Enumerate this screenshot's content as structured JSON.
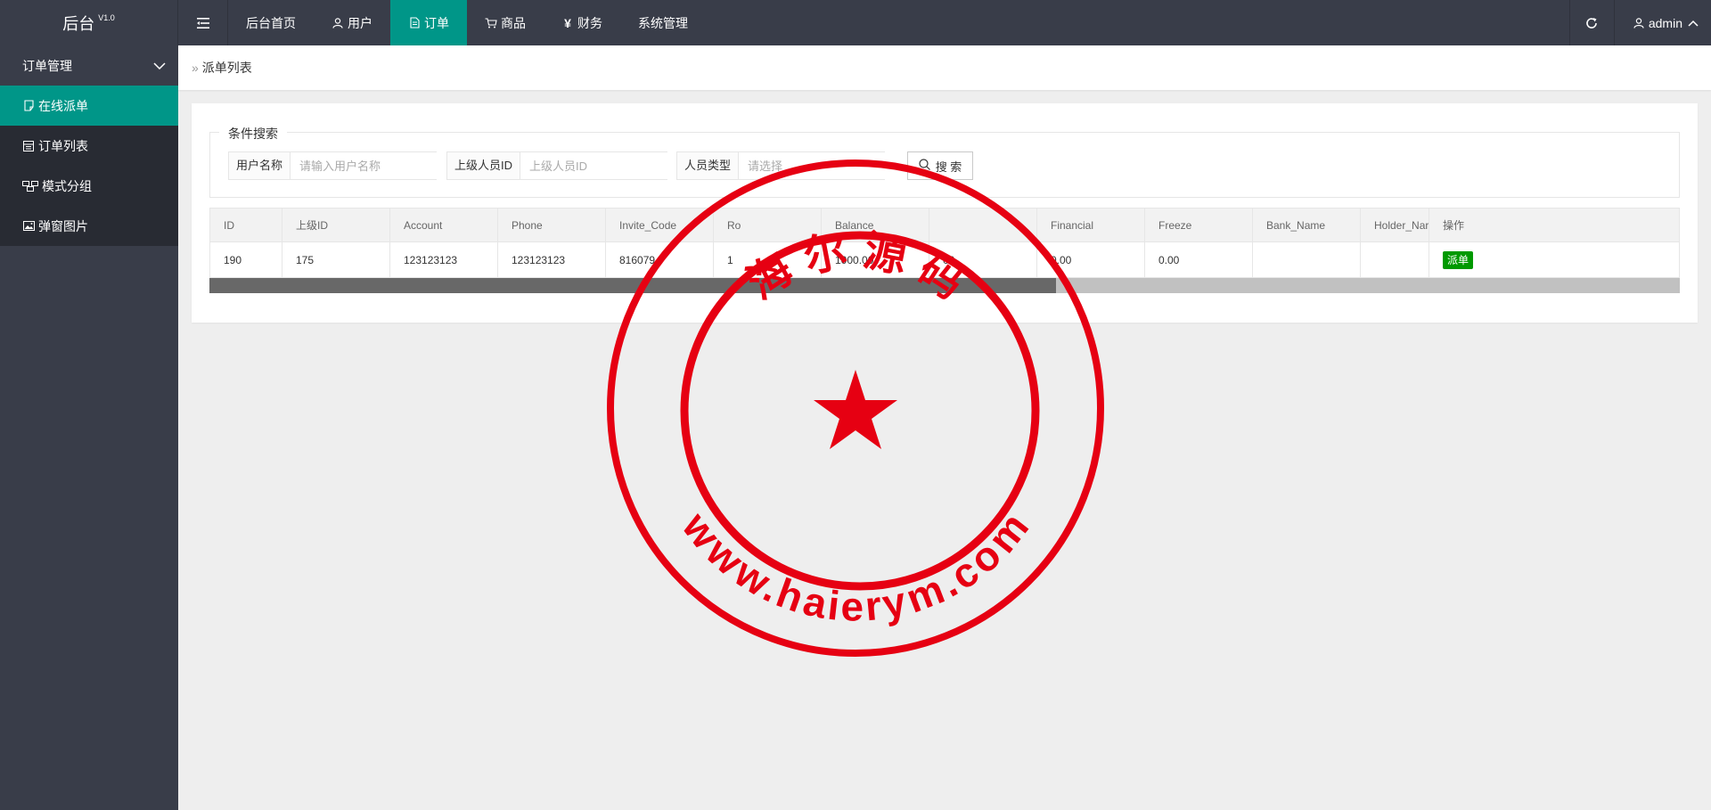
{
  "header": {
    "logo_text": "后台",
    "logo_version": "V1.0",
    "nav": [
      {
        "label": "后台首页",
        "icon": "none",
        "active": false
      },
      {
        "label": "用户",
        "icon": "user-icon",
        "active": false
      },
      {
        "label": "订单",
        "icon": "document-icon",
        "active": true
      },
      {
        "label": "商品",
        "icon": "cart-icon",
        "active": false
      },
      {
        "label": "财务",
        "icon": "yen-icon",
        "active": false
      },
      {
        "label": "系统管理",
        "icon": "none",
        "active": false
      }
    ],
    "user_name": "admin"
  },
  "sidebar": {
    "group_label": "订单管理",
    "items": [
      {
        "label": "在线派单",
        "icon": "note-icon",
        "active": true
      },
      {
        "label": "订单列表",
        "icon": "list-icon",
        "active": false
      },
      {
        "label": "模式分组",
        "icon": "group-icon",
        "active": false
      },
      {
        "label": "弹窗图片",
        "icon": "image-icon",
        "active": false
      }
    ]
  },
  "breadcrumb": {
    "current": "派单列表"
  },
  "search": {
    "legend": "条件搜索",
    "username_label": "用户名称",
    "username_placeholder": "请输入用户名称",
    "parent_label": "上级人员ID",
    "parent_placeholder": "上级人员ID",
    "type_label": "人员类型",
    "type_placeholder": "请选择",
    "button_label": "搜 索"
  },
  "table": {
    "columns": [
      "ID",
      "上级ID",
      "Account",
      "Phone",
      "Invite_Code",
      "Ro",
      "Balance",
      "",
      "Financial",
      "Freeze",
      "Bank_Name",
      "Holder_Nar",
      "操作"
    ],
    "rows": [
      [
        "190",
        "175",
        "123123123",
        "123123123",
        "816079",
        "1",
        "1000.00",
        "00",
        "0.00",
        "0.00",
        "",
        ""
      ]
    ],
    "action_label": "派单"
  },
  "stamp": {
    "top_text": "海 尔 源 码",
    "bottom_text": "www.haierym.com",
    "color": "#e60012"
  },
  "colors": {
    "header_bg": "#393d49",
    "accent": "#009688",
    "action_green": "#009900"
  }
}
